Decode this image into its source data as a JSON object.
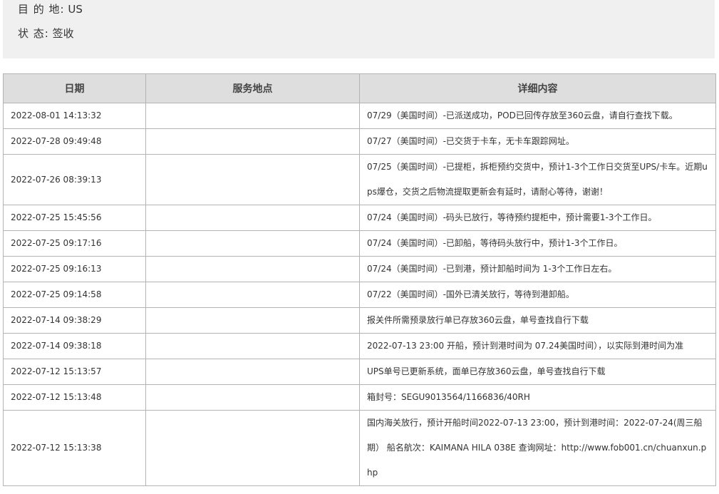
{
  "info": {
    "destination_label": "目 的 地:",
    "destination_value": "US",
    "status_label": "状 态:",
    "status_value": "签收"
  },
  "table": {
    "headers": {
      "date": "日期",
      "location": "服务地点",
      "detail": "详细内容"
    },
    "rows": [
      {
        "date": "2022-08-01 14:13:32",
        "location": "",
        "detail": "07/29（美国时间）-已派送成功，POD已回传存放至360云盘，请自行查找下载。"
      },
      {
        "date": "2022-07-28 09:49:48",
        "location": "",
        "detail": "07/27（美国时间）-已交货于卡车，无卡车跟踪网址。"
      },
      {
        "date": "2022-07-26 08:39:13",
        "location": "",
        "detail": "07/25（美国时间）-已提柜，拆柜预约交货中，预计1-3个工作日交货至UPS/卡车。近期ups爆仓，交货之后物流提取更新会有延时，请耐心等待，谢谢！"
      },
      {
        "date": "2022-07-25 15:45:56",
        "location": "",
        "detail": "07/24（美国时间）-码头已放行，等待预约提柜中，预计需要1-3个工作日。"
      },
      {
        "date": "2022-07-25 09:17:16",
        "location": "",
        "detail": "07/24（美国时间）-已卸船，等待码头放行中，预计1-3个工作日。"
      },
      {
        "date": "2022-07-25 09:16:13",
        "location": "",
        "detail": "07/24（美国时间）-已到港，预计卸船时间为 1-3个工作日左右。"
      },
      {
        "date": "2022-07-25 09:14:58",
        "location": "",
        "detail": "07/22（美国时间）-国外已清关放行，等待到港卸船。"
      },
      {
        "date": "2022-07-14 09:38:29",
        "location": "",
        "detail": "报关件所需预录放行单已存放360云盘，单号查找自行下载"
      },
      {
        "date": "2022-07-14 09:38:18",
        "location": "",
        "detail": "2022-07-13 23:00 开船，预计到港时间为 07.24美国时间），以实际到港时间为准"
      },
      {
        "date": "2022-07-12 15:13:57",
        "location": "",
        "detail": "UPS单号已更新系统，面单已存放360云盘，单号查找自行下载"
      },
      {
        "date": "2022-07-12 15:13:48",
        "location": "",
        "detail": "箱封号：SEGU9013564/1166836/40RH"
      },
      {
        "date": "2022-07-12 15:13:38",
        "location": "",
        "detail": "国内海关放行，预计开船时间2022-07-13 23:00，预计到港时间：2022-07-24(周三船期） 船名航次：KAIMANA HILA 038E 查询网址：http://www.fob001.cn/chuanxun.php"
      }
    ]
  }
}
